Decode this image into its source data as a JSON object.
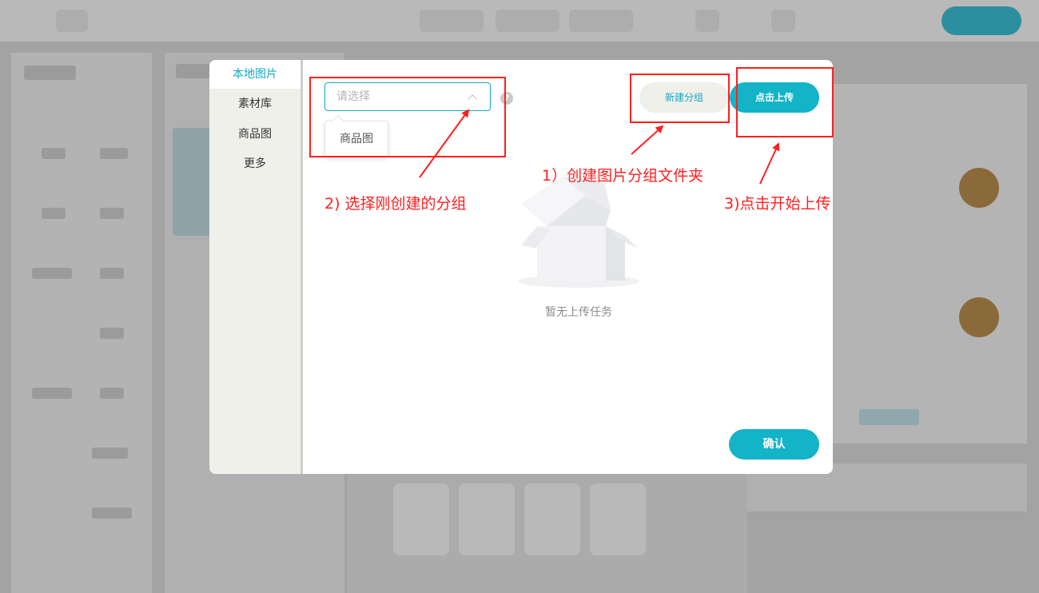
{
  "dialog": {
    "sidebar": {
      "items": [
        {
          "label": "本地图片",
          "active": true
        },
        {
          "label": "素材库",
          "active": false
        },
        {
          "label": "商品图",
          "active": false
        },
        {
          "label": "更多",
          "active": false
        }
      ]
    },
    "group_select": {
      "placeholder": "请选择",
      "dropdown_options": [
        "商品图"
      ]
    },
    "help_icon_glyph": "?",
    "new_group_button": "新建分组",
    "upload_button": "点击上传",
    "empty_state_text": "暂无上传任务",
    "confirm_button": "确认"
  },
  "annotations": {
    "step1": "1）创建图片分组文件夹",
    "step2": "2) 选择刚创建的分组",
    "step3": "3)点击开始上传"
  },
  "colors": {
    "accent": "#13b3c8",
    "annotation_red": "#ff1f1f",
    "overlay": "#a3a3a3"
  },
  "icons": {
    "empty_box": "empty-box-illustration",
    "help": "question-circle-icon",
    "chevron": "chevron-up-icon"
  }
}
